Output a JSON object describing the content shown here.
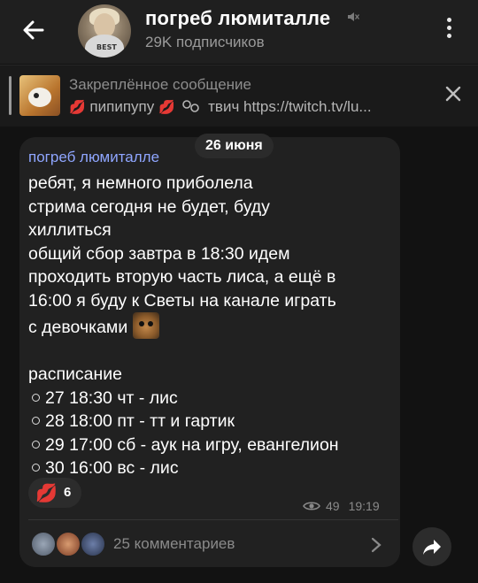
{
  "header": {
    "title": "погреб люмиталле",
    "subscribers": "29K подписчиков",
    "icons": [
      "back-arrow-icon",
      "muted-speaker-icon",
      "more-vertical-icon"
    ]
  },
  "pinned": {
    "title": "Закреплённое сообщение",
    "text": "пипипупу",
    "link_text": "твич https://twitch.tv/lu...",
    "icons": [
      "lips-emoji",
      "link-icon",
      "close-icon"
    ]
  },
  "message": {
    "date": "26 июня",
    "sender": "погреб люмиталле",
    "lines": [
      "ребят, я немного приболела",
      "стрима сегодня не будет, буду",
      "хиллиться",
      "общий сбор завтра в 18:30 идем",
      "проходить вторую часть лиса, а ещё в",
      "16:00 я буду к Светы на канале играть",
      "с девочками"
    ],
    "schedule_title": "расписание",
    "schedule": [
      "27 18:30 чт - лис",
      "28 18:00 пт - тт и гартик",
      "29 17:00 сб - аук на игру, евангелион",
      "30 16:00 вс - лис"
    ],
    "reaction": {
      "emoji": "💋",
      "count": "6"
    },
    "views": "49",
    "time": "19:19",
    "comments": "25 комментариев"
  },
  "colors": {
    "background": "#121212",
    "header": "#1f1f1f",
    "bubble": "#212121",
    "sender": "#8fa6ff",
    "muted_text": "#8a8a8a"
  }
}
